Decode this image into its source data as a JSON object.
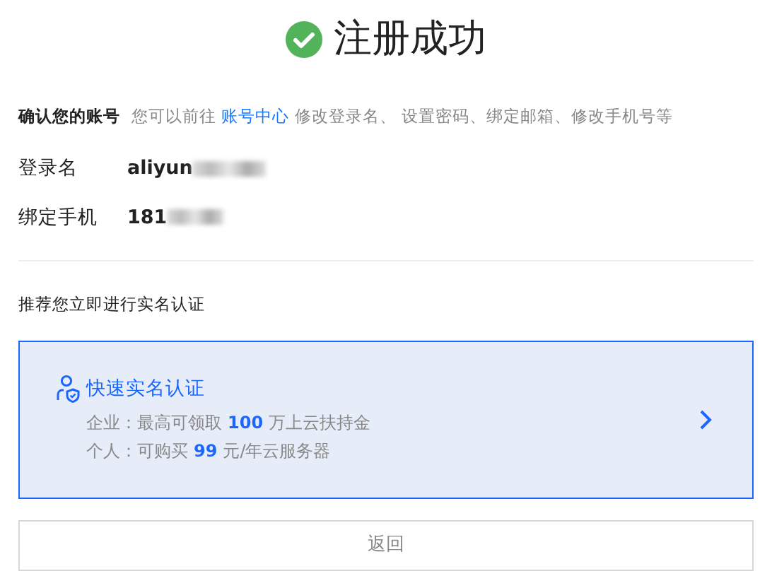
{
  "title": "注册成功",
  "confirm": {
    "label": "确认您的账号",
    "before": "您可以前往",
    "link": "账号中心",
    "after": "修改登录名、 设置密码、绑定邮箱、修改手机号等"
  },
  "fields": [
    {
      "label": "登录名",
      "value": "aliyun"
    },
    {
      "label": "绑定手机",
      "value": "181"
    }
  ],
  "recommend": "推荐您立即进行实名认证",
  "verify_card": {
    "title": "快速实名认证",
    "lines": [
      [
        {
          "text": "企业：最高可领取",
          "highlight": false
        },
        {
          "text": "100",
          "highlight": true
        },
        {
          "text": "万上云扶持金",
          "highlight": false
        }
      ],
      [
        {
          "text": "个人：可购买",
          "highlight": false
        },
        {
          "text": "99",
          "highlight": true
        },
        {
          "text": "元/年云服务器",
          "highlight": false
        }
      ]
    ]
  },
  "back_button": "返回"
}
